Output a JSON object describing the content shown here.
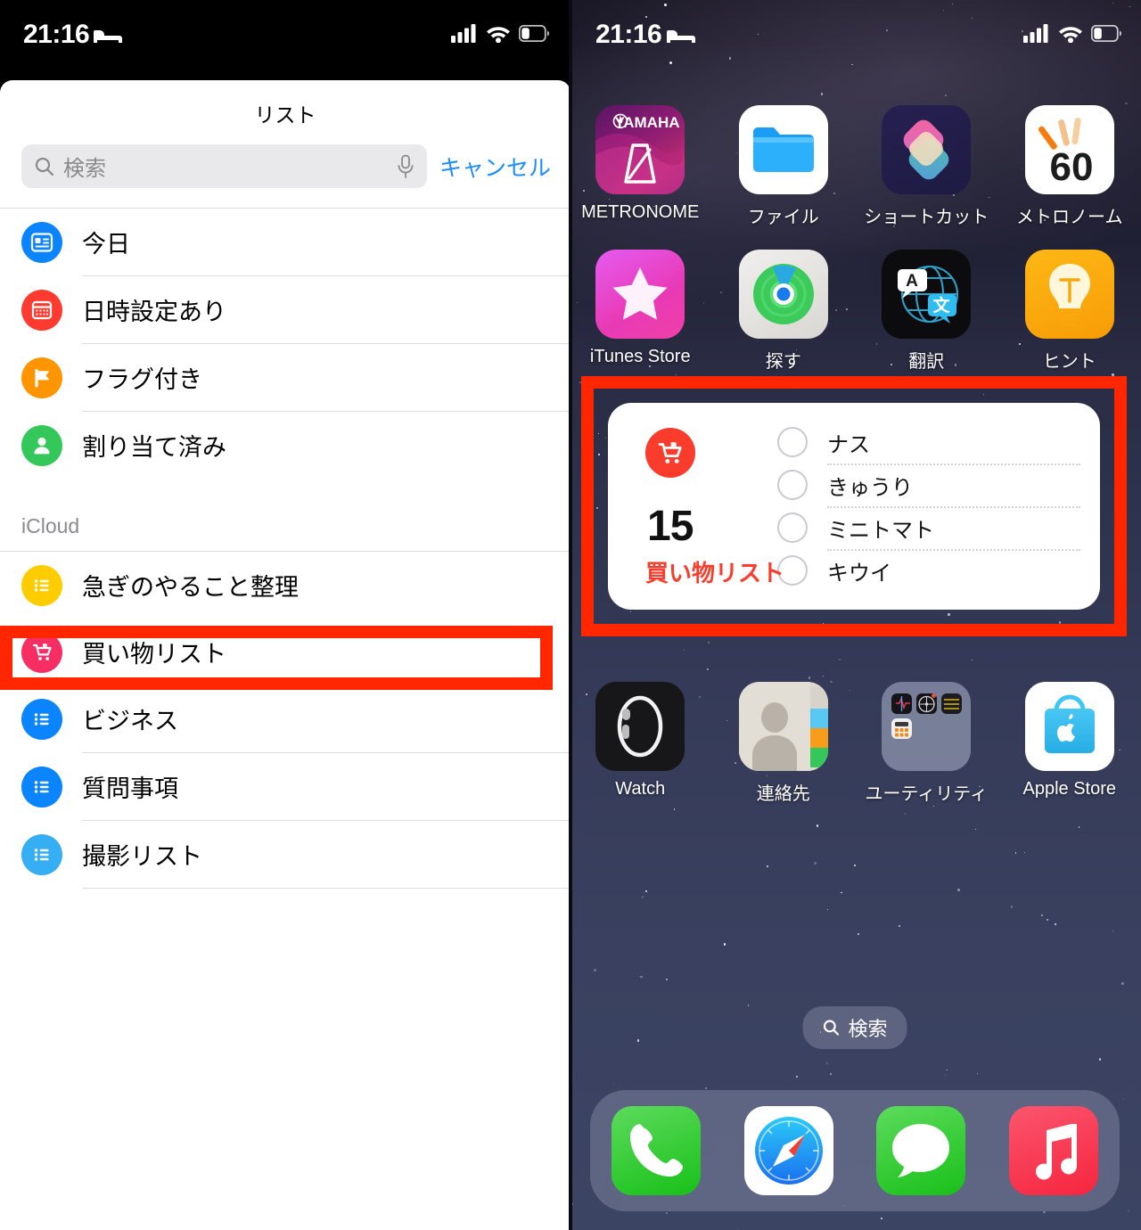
{
  "left_phone": {
    "status_bar": {
      "time": "21:16",
      "bed_icon": "bed-icon",
      "signal_icon": "cellular-signal-icon",
      "wifi_icon": "wifi-icon",
      "battery_icon": "battery-icon"
    },
    "sheet_title": "リスト",
    "search": {
      "placeholder": "検索",
      "value": "",
      "search_icon": "search-icon",
      "mic_icon": "microphone-icon"
    },
    "cancel_label": "キャンセル",
    "smart_lists": [
      {
        "label": "今日",
        "icon": "today-calendar-icon",
        "color": "#0a84ff"
      },
      {
        "label": "日時設定あり",
        "icon": "scheduled-calendar-icon",
        "color": "#ff3b30"
      },
      {
        "label": "フラグ付き",
        "icon": "flag-icon",
        "color": "#ff9500"
      },
      {
        "label": "割り当て済み",
        "icon": "person-icon",
        "color": "#34c759"
      }
    ],
    "section_header": "iCloud",
    "icloud_lists": [
      {
        "label": "急ぎのやること整理",
        "icon": "list-bullet-icon",
        "color": "#ffcc00",
        "highlighted": false
      },
      {
        "label": "買い物リスト",
        "icon": "shopping-cart-icon",
        "color": "#f72e63",
        "highlighted": true
      },
      {
        "label": "ビジネス",
        "icon": "list-bullet-icon",
        "color": "#0a84ff",
        "highlighted": false
      },
      {
        "label": "質問事項",
        "icon": "list-bullet-icon",
        "color": "#0a84ff",
        "highlighted": false
      },
      {
        "label": "撮影リスト",
        "icon": "list-bullet-icon",
        "color": "#35aef4",
        "highlighted": false
      }
    ],
    "highlight_color": "#ff2600"
  },
  "right_phone": {
    "status_bar": {
      "time": "21:16",
      "bed_icon": "bed-icon",
      "signal_icon": "cellular-signal-icon",
      "wifi_icon": "wifi-icon",
      "battery_icon": "battery-icon"
    },
    "apps_row1": [
      {
        "label": "METRONOME",
        "icon": "yamaha-metronome-icon"
      },
      {
        "label": "ファイル",
        "icon": "files-icon"
      },
      {
        "label": "ショートカット",
        "icon": "shortcuts-icon"
      },
      {
        "label": "メトロノーム",
        "icon": "metronome-60-icon"
      }
    ],
    "apps_row2": [
      {
        "label": "iTunes Store",
        "icon": "itunes-store-icon"
      },
      {
        "label": "探す",
        "icon": "find-my-icon"
      },
      {
        "label": "翻訳",
        "icon": "translate-icon"
      },
      {
        "label": "ヒント",
        "icon": "tips-icon"
      }
    ],
    "apps_row3": [
      {
        "label": "Watch",
        "icon": "watch-icon"
      },
      {
        "label": "連絡先",
        "icon": "contacts-icon"
      },
      {
        "label": "ユーティリティ",
        "icon": "utilities-folder-icon"
      },
      {
        "label": "Apple Store",
        "icon": "apple-store-icon"
      }
    ],
    "widget": {
      "count": "15",
      "title": "買い物リスト",
      "cart_icon": "shopping-cart-icon",
      "items": [
        {
          "label": "ナス",
          "checked": false
        },
        {
          "label": "きゅうり",
          "checked": false
        },
        {
          "label": "ミニトマト",
          "checked": false
        },
        {
          "label": "キウイ",
          "checked": false
        }
      ],
      "accent_color": "#fa3c2d",
      "highlight_color": "#ff2600"
    },
    "search_pill": {
      "label": "検索",
      "icon": "search-icon"
    },
    "dock": [
      {
        "label": "電話",
        "icon": "phone-icon"
      },
      {
        "label": "Safari",
        "icon": "safari-icon"
      },
      {
        "label": "メッセージ",
        "icon": "messages-icon"
      },
      {
        "label": "ミュージック",
        "icon": "music-icon"
      }
    ]
  }
}
